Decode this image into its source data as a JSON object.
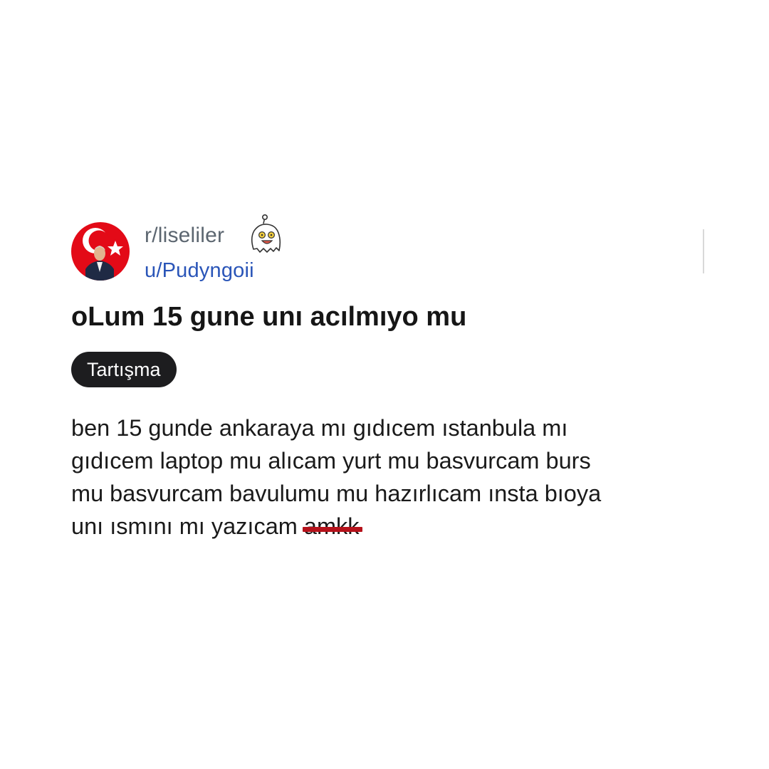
{
  "post": {
    "subreddit": "r/liseliler",
    "username": "u/Pudyngoii",
    "title": "oLum 15 gune unı acılmıyo mu",
    "flair": "Tartışma",
    "body_lines": [
      "ben 15 gunde ankaraya mı gıdıcem ıstanbula mı",
      "gıdıcem laptop mu alıcam yurt mu basvurcam burs",
      "mu basvurcam bavulumu mu hazırlıcam ınsta bıoya"
    ],
    "body_last_line": "unı ısmını mı yazıcam ",
    "body_struck_word": "amkk",
    "icons": {
      "avatar": "turkish-flag-portrait-avatar",
      "badge": "ghost-snoo-icon"
    },
    "colors": {
      "subreddit": "#5c6670",
      "username": "#2a55b8",
      "flair_bg": "#1d1d1f",
      "strike": "#b5121b"
    }
  }
}
